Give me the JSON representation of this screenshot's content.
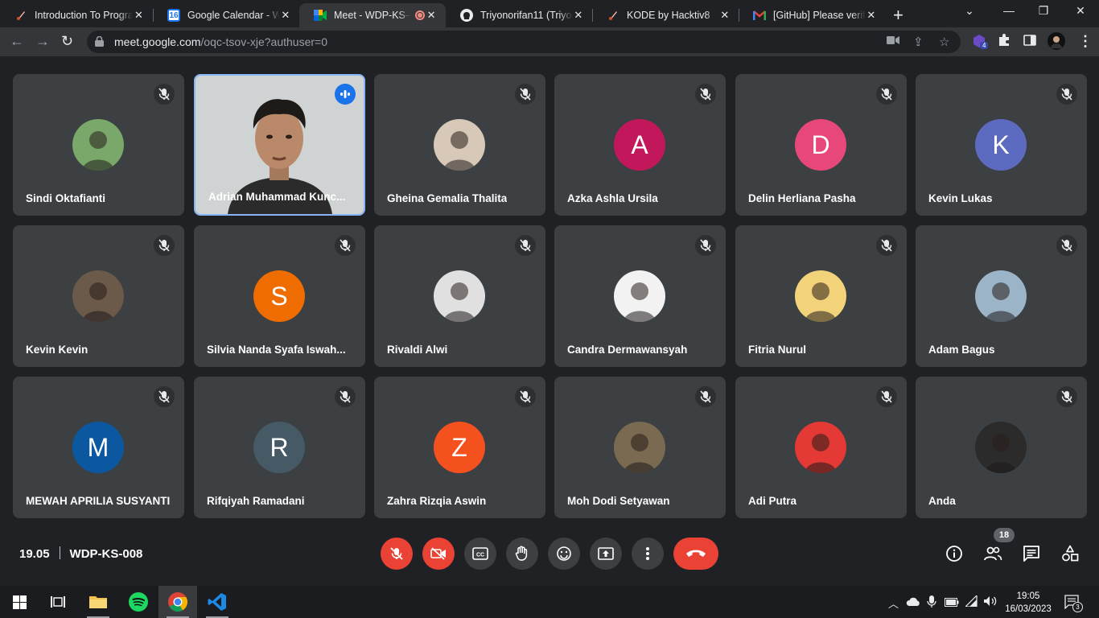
{
  "browser": {
    "tabs": [
      {
        "label": "Introduction To Progra",
        "favicon": "hacktiv-icon"
      },
      {
        "label": "Google Calendar - We",
        "favicon": "calendar-icon",
        "fav_text": "16"
      },
      {
        "label": "Meet - WDP-KS-0",
        "favicon": "meet-icon"
      },
      {
        "label": "Triyonorifan11 (Triyon",
        "favicon": "github-icon"
      },
      {
        "label": "KODE by Hacktiv8",
        "favicon": "hacktiv-icon"
      },
      {
        "label": "[GitHub] Please verify",
        "favicon": "gmail-icon"
      }
    ],
    "url_host": "meet.google.com",
    "url_path": "/oqc-tsov-xje?authuser=0",
    "extension_badge": "4"
  },
  "participants": [
    {
      "name": "Sindi Oktafianti",
      "avatar": "photo",
      "color": "#7aa86a"
    },
    {
      "name": "Adrian Muhammad Kunc...",
      "avatar": "video"
    },
    {
      "name": "Gheina Gemalia Thalita",
      "avatar": "photo",
      "color": "#d8c8b8"
    },
    {
      "name": "Azka Ashla Ursila",
      "avatar": "letter",
      "letter": "A",
      "color": "#c2185b"
    },
    {
      "name": "Delin Herliana Pasha",
      "avatar": "letter",
      "letter": "D",
      "color": "#e8477a"
    },
    {
      "name": "Kevin Lukas",
      "avatar": "letter",
      "letter": "K",
      "color": "#5c6bc0"
    },
    {
      "name": "Kevin Kevin",
      "avatar": "photo",
      "color": "#6b5a4a"
    },
    {
      "name": "Silvia Nanda Syafa Iswah...",
      "avatar": "letter",
      "letter": "S",
      "color": "#ef6c00"
    },
    {
      "name": "Rivaldi Alwi",
      "avatar": "photo",
      "color": "#e0e0e0"
    },
    {
      "name": "Candra Dermawansyah",
      "avatar": "photo",
      "color": "#f2f2f2"
    },
    {
      "name": "Fitria Nurul",
      "avatar": "photo",
      "color": "#f3d37a"
    },
    {
      "name": "Adam Bagus",
      "avatar": "photo",
      "color": "#9cb4c8"
    },
    {
      "name": "MEWAH APRILIA SUSYANTI",
      "avatar": "letter",
      "letter": "M",
      "color": "#0b57a0"
    },
    {
      "name": "Rifqiyah Ramadani",
      "avatar": "letter",
      "letter": "R",
      "color": "#455a64"
    },
    {
      "name": "Zahra Rizqia Aswin",
      "avatar": "letter",
      "letter": "Z",
      "color": "#f4511e"
    },
    {
      "name": "Moh Dodi Setyawan",
      "avatar": "photo",
      "color": "#7a6a52"
    },
    {
      "name": "Adi Putra",
      "avatar": "photo",
      "color": "#e53935"
    },
    {
      "name": "Anda",
      "avatar": "photo",
      "color": "#2b2b2b"
    }
  ],
  "meeting": {
    "time": "19.05",
    "code": "WDP-KS-008",
    "people_count": "18"
  },
  "taskbar": {
    "time": "19:05",
    "date": "16/03/2023",
    "notifications": "3"
  }
}
